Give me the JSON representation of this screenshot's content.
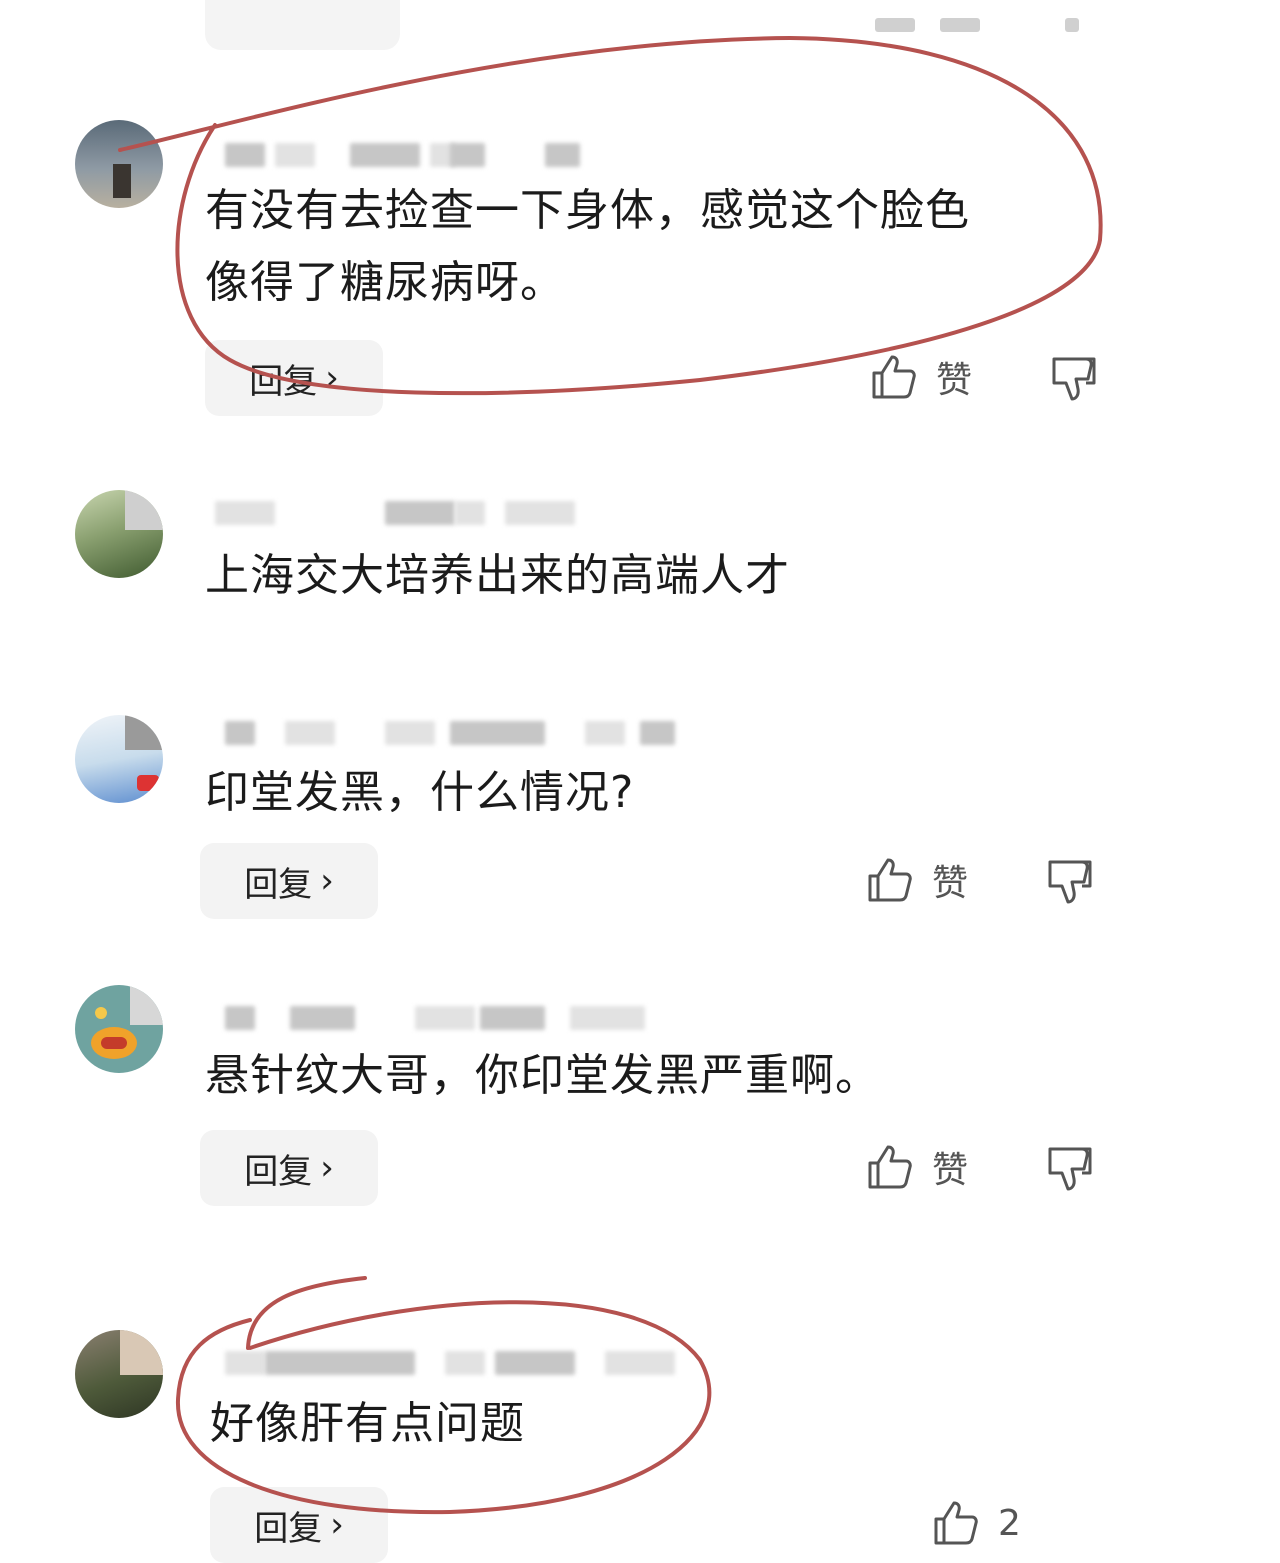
{
  "comments": [
    {
      "text_lines": [
        "有没有去捡查一下身体，感觉这个脸色",
        "像得了糖尿病呀。"
      ],
      "reply_label": "回复",
      "like_label": "赞"
    },
    {
      "text_lines": [
        "上海交大培养出来的高端人才"
      ]
    },
    {
      "text_lines": [
        "印堂发黑，什么情况?"
      ],
      "reply_label": "回复",
      "like_label": "赞"
    },
    {
      "text_lines": [
        "悬针纹大哥，你印堂发黑严重啊。"
      ],
      "reply_label": "回复",
      "like_label": "赞"
    },
    {
      "text_lines": [
        "好像肝有点问题"
      ],
      "reply_label": "回复",
      "like_label": "2"
    }
  ],
  "icons": {
    "thumb_up": "thumbs-up-icon",
    "thumb_down": "thumbs-down-icon",
    "chevron": "chevron-right-icon"
  },
  "colors": {
    "annotation_circle": "#b5524f",
    "reply_background": "#f3f3f3",
    "icon_grey": "#555555"
  }
}
